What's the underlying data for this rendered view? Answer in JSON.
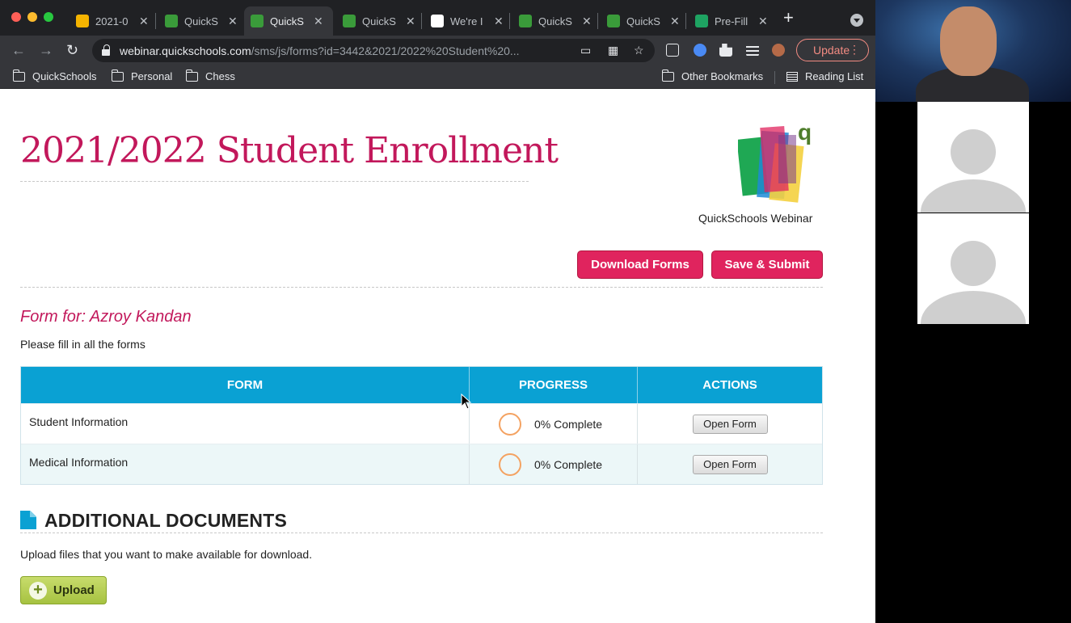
{
  "browser": {
    "tabs": [
      {
        "title": "2021-0",
        "active": false,
        "favicon_color": "#f5b400"
      },
      {
        "title": "QuickS",
        "active": false,
        "favicon_color": "#3a9b3a"
      },
      {
        "title": "QuickS",
        "active": true,
        "favicon_color": "#3a9b3a"
      },
      {
        "title": "QuickS",
        "active": false,
        "favicon_color": "#3a9b3a"
      },
      {
        "title": "We're I",
        "active": false,
        "favicon_color": "#ffffff"
      },
      {
        "title": "QuickS",
        "active": false,
        "favicon_color": "#3a9b3a"
      },
      {
        "title": "QuickS",
        "active": false,
        "favicon_color": "#3a9b3a"
      },
      {
        "title": "Pre-Fill",
        "active": false,
        "favicon_color": "#1ea362"
      }
    ],
    "url_host": "webinar.quickschools.com",
    "url_path": "/sms/js/forms?id=3442&2021/2022%20Student%20...",
    "update_label": "Update",
    "bookmarks": [
      "QuickSchools",
      "Personal",
      "Chess"
    ],
    "bookmarks_right": [
      "Other Bookmarks",
      "Reading List"
    ]
  },
  "page": {
    "title": "2021/2022 Student Enrollment",
    "org_name": "QuickSchools Webinar",
    "download_label": "Download Forms",
    "submit_label": "Save & Submit",
    "form_for": "Form for: Azroy Kandan",
    "instructions": "Please fill in all the forms",
    "table": {
      "headers": [
        "FORM",
        "PROGRESS",
        "ACTIONS"
      ],
      "rows": [
        {
          "form": "Student Information",
          "progress": "0% Complete",
          "action": "Open Form"
        },
        {
          "form": "Medical Information",
          "progress": "0% Complete",
          "action": "Open Form"
        }
      ]
    },
    "additional_title": "ADDITIONAL DOCUMENTS",
    "upload_text": "Upload files that you want to make available for download.",
    "upload_label": "Upload"
  },
  "colors": {
    "accent_pink": "#c2185b",
    "button_red": "#e0245e",
    "table_header": "#0aa1d3",
    "upload_green": "#a6c241"
  }
}
